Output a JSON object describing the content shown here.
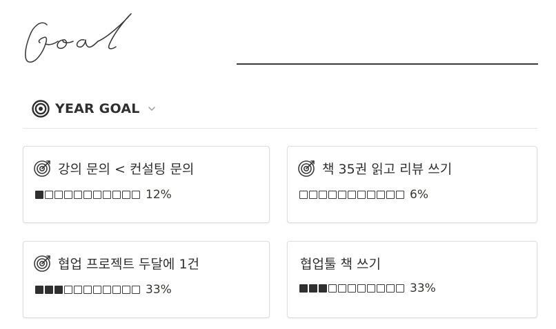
{
  "header": {
    "logo_text": "Goal"
  },
  "database": {
    "icon": "target-icon",
    "title": "YEAR GOAL",
    "toggle_icon": "chevron-down-icon"
  },
  "cards": [
    {
      "title": "강의 문의 < 컨설팅 문의",
      "icon": "target-icon",
      "progress_text": "12%",
      "progress": 0.12,
      "filled_blocks": 1,
      "total_blocks": 11
    },
    {
      "title": "책 35권 읽고 리뷰 쓰기",
      "icon": "target-icon",
      "progress_text": "6%",
      "progress": 0.06,
      "filled_blocks": 0,
      "total_blocks": 11
    },
    {
      "title": "협업 프로젝트 두달에 1건",
      "icon": "target-icon",
      "progress_text": "33%",
      "progress": 0.33,
      "filled_blocks": 3,
      "total_blocks": 11
    },
    {
      "title": "협업툴 책 쓰기",
      "icon": "",
      "progress_text": "33%",
      "progress": 0.33,
      "filled_blocks": 3,
      "total_blocks": 11
    }
  ],
  "colors": {
    "text": "#37352f",
    "filled_block": "#2f2f2f",
    "card_border": "#dededc",
    "divider": "#e6e6e4"
  }
}
